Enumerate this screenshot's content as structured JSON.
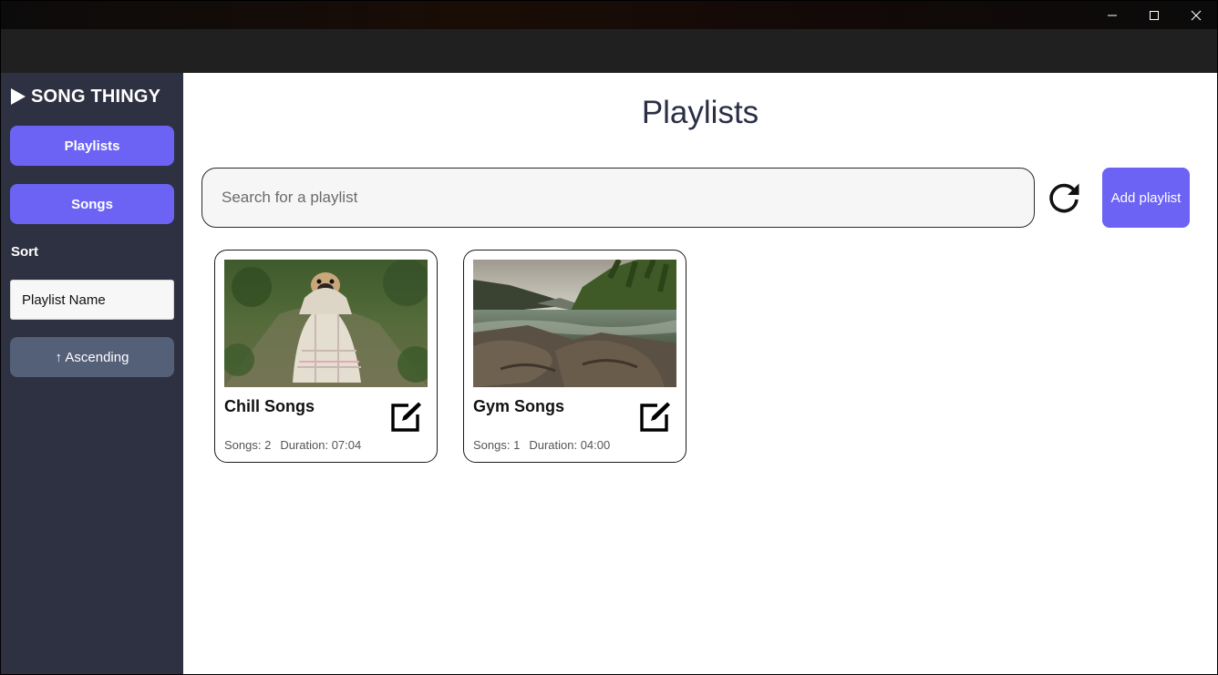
{
  "window": {
    "controls": [
      "minimize-icon",
      "maximize-icon",
      "close-icon"
    ]
  },
  "sidebar": {
    "brand": "SONG THINGY",
    "brand_icon": "play-icon",
    "nav": {
      "playlists": "Playlists",
      "songs": "Songs"
    },
    "sort_label": "Sort",
    "sort_select_value": "Playlist Name",
    "sort_direction": "↑ Ascending"
  },
  "main": {
    "title": "Playlists",
    "search_placeholder": "Search for a playlist",
    "refresh_icon": "refresh-icon",
    "add_button": "Add playlist",
    "playlists": [
      {
        "name": "Chill Songs",
        "songs": "Songs: 2",
        "duration": "Duration: 07:04",
        "image": "pug-in-blanket-photo",
        "edit_icon": "edit-icon"
      },
      {
        "name": "Gym Songs",
        "songs": "Songs: 1",
        "duration": "Duration: 04:00",
        "image": "river-landscape-photo",
        "edit_icon": "edit-icon"
      }
    ]
  },
  "colors": {
    "accent": "#6c63f4",
    "sidebar_bg": "#2e3141",
    "sort_button_bg": "#545f78",
    "title_text": "#2b2f45"
  }
}
